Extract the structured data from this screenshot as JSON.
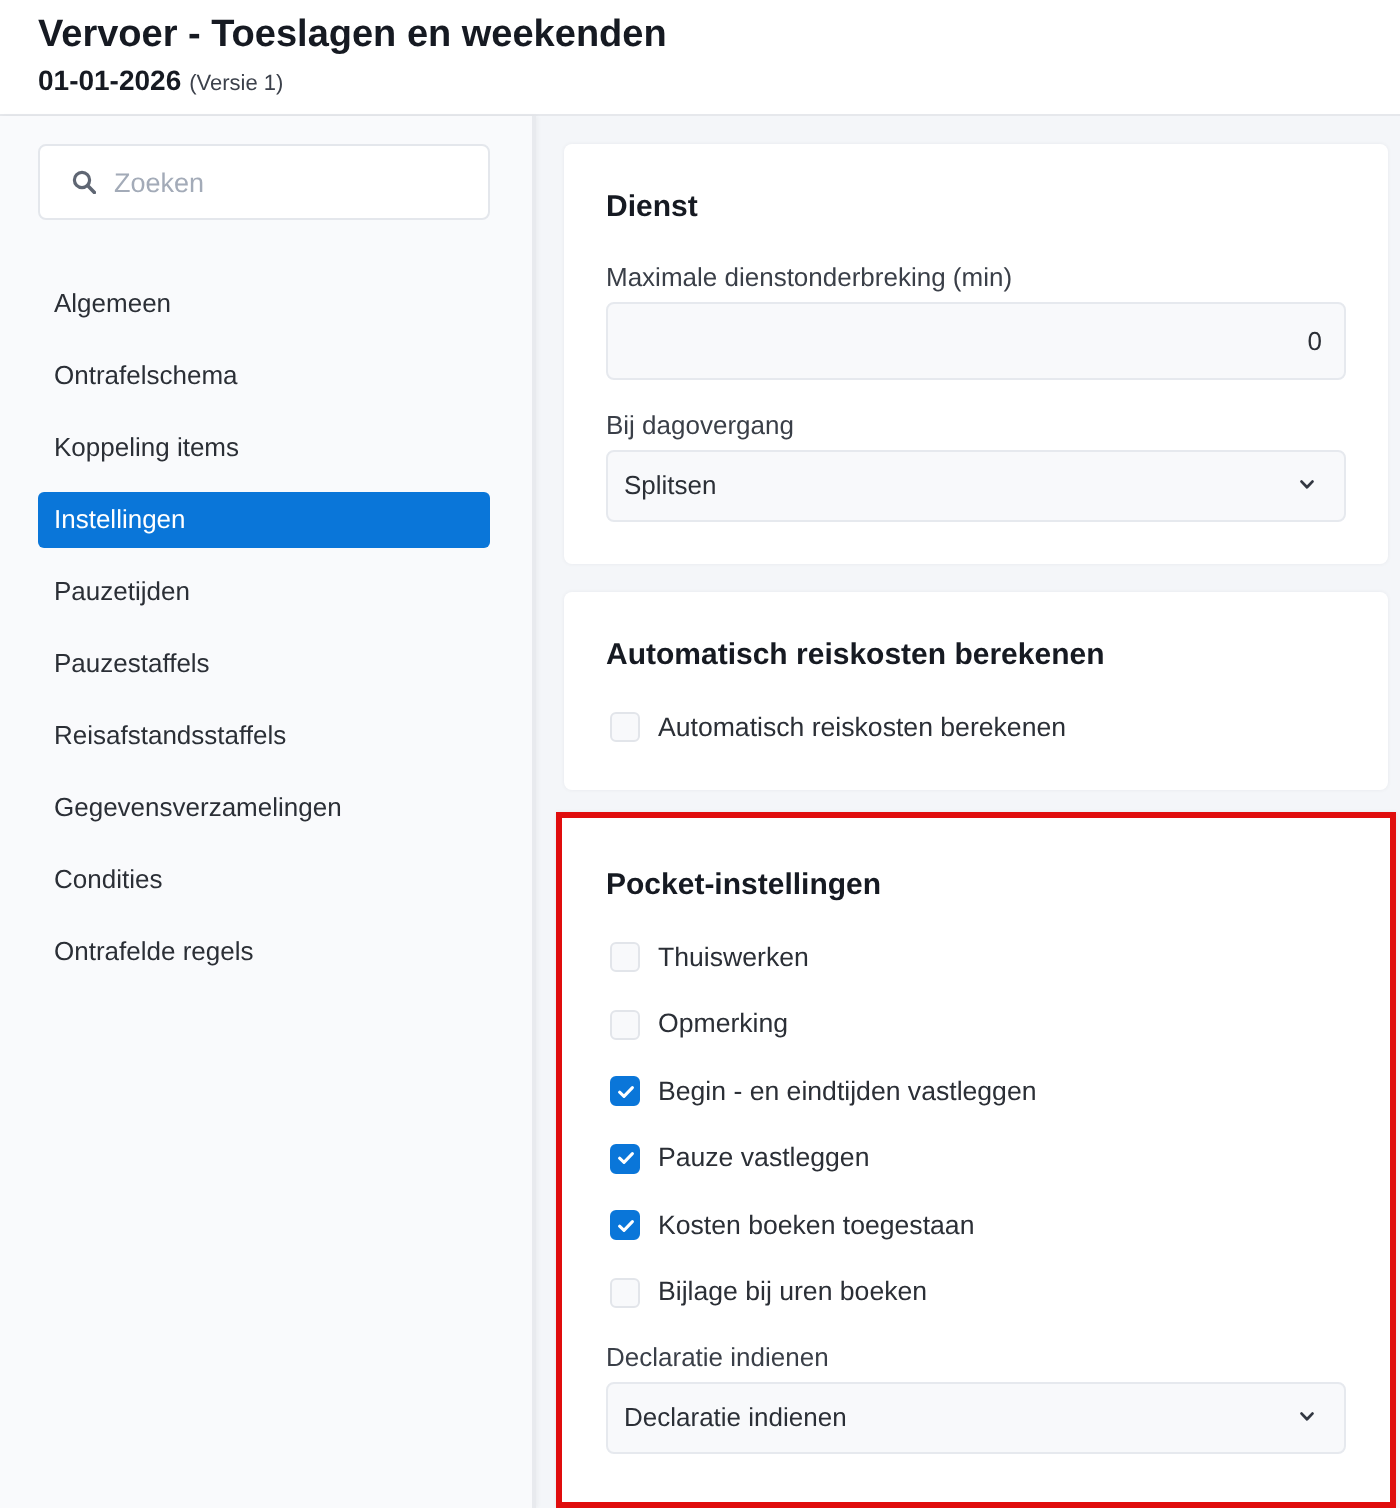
{
  "header": {
    "title": "Vervoer - Toeslagen en weekenden",
    "date": "01-01-2026",
    "version": "(Versie 1)"
  },
  "sidebar": {
    "search": {
      "placeholder": "Zoeken"
    },
    "items": [
      {
        "label": "Algemeen",
        "selected": false
      },
      {
        "label": "Ontrafelschema",
        "selected": false
      },
      {
        "label": "Koppeling items",
        "selected": false
      },
      {
        "label": "Instellingen",
        "selected": true
      },
      {
        "label": "Pauzetijden",
        "selected": false
      },
      {
        "label": "Pauzestaffels",
        "selected": false
      },
      {
        "label": "Reisafstandsstaffels",
        "selected": false
      },
      {
        "label": "Gegevensverzamelingen",
        "selected": false
      },
      {
        "label": "Condities",
        "selected": false
      },
      {
        "label": "Ontrafelde regels",
        "selected": false
      }
    ]
  },
  "sections": [
    {
      "title": "Dienst",
      "highlighted": false,
      "fields": [
        {
          "kind": "number",
          "label": "Maximale dienstonderbreking (min)",
          "value": "0"
        },
        {
          "kind": "select",
          "label": "Bij dagovergang",
          "value": "Splitsen"
        }
      ]
    },
    {
      "title": "Automatisch reiskosten berekenen",
      "highlighted": false,
      "fields": [
        {
          "kind": "checkbox",
          "label": "Automatisch reiskosten berekenen",
          "checked": false
        }
      ]
    },
    {
      "title": "Pocket-instellingen",
      "highlighted": true,
      "fields": [
        {
          "kind": "checkbox",
          "label": "Thuiswerken",
          "checked": false
        },
        {
          "kind": "checkbox",
          "label": "Opmerking",
          "checked": false
        },
        {
          "kind": "checkbox",
          "label": "Begin - en eindtijden vastleggen",
          "checked": true
        },
        {
          "kind": "checkbox",
          "label": "Pauze vastleggen",
          "checked": true
        },
        {
          "kind": "checkbox",
          "label": "Kosten boeken toegestaan",
          "checked": true
        },
        {
          "kind": "checkbox",
          "label": "Bijlage bij uren boeken",
          "checked": false
        },
        {
          "kind": "select",
          "label": "Declaratie indienen",
          "value": "Declaratie indienen"
        }
      ]
    }
  ]
}
